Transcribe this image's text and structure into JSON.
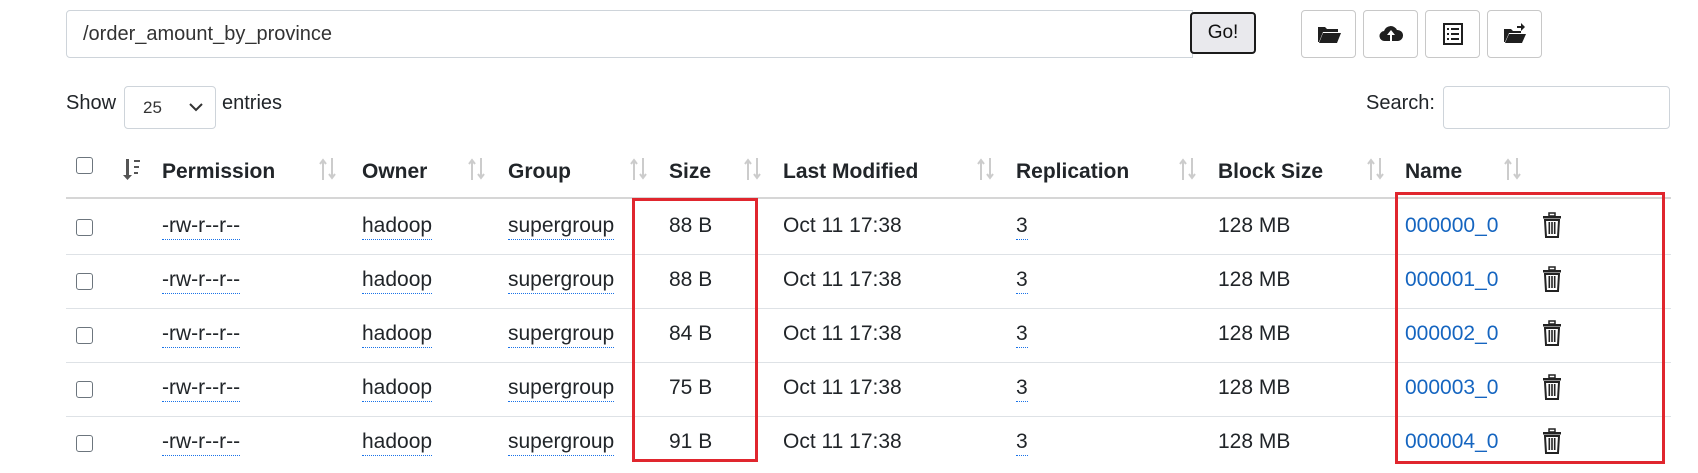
{
  "path_bar": {
    "value": "/order_amount_by_province",
    "go_label": "Go!"
  },
  "toolbar": {
    "icons": [
      "folder-open-icon",
      "cloud-upload-icon",
      "list-icon",
      "folder-move-icon"
    ]
  },
  "length_menu": {
    "show_label": "Show",
    "selected": "25",
    "entries_label": "entries"
  },
  "search": {
    "label": "Search:",
    "value": ""
  },
  "table": {
    "headers": {
      "permission": "Permission",
      "owner": "Owner",
      "group": "Group",
      "size": "Size",
      "last_modified": "Last Modified",
      "replication": "Replication",
      "block_size": "Block Size",
      "name": "Name"
    },
    "rows": [
      {
        "permission": "-rw-r--r--",
        "owner": "hadoop",
        "group": "supergroup",
        "size": "88 B",
        "last_modified": "Oct 11 17:38",
        "replication": "3",
        "block_size": "128 MB",
        "name": "000000_0"
      },
      {
        "permission": "-rw-r--r--",
        "owner": "hadoop",
        "group": "supergroup",
        "size": "88 B",
        "last_modified": "Oct 11 17:38",
        "replication": "3",
        "block_size": "128 MB",
        "name": "000001_0"
      },
      {
        "permission": "-rw-r--r--",
        "owner": "hadoop",
        "group": "supergroup",
        "size": "84 B",
        "last_modified": "Oct 11 17:38",
        "replication": "3",
        "block_size": "128 MB",
        "name": "000002_0"
      },
      {
        "permission": "-rw-r--r--",
        "owner": "hadoop",
        "group": "supergroup",
        "size": "75 B",
        "last_modified": "Oct 11 17:38",
        "replication": "3",
        "block_size": "128 MB",
        "name": "000003_0"
      },
      {
        "permission": "-rw-r--r--",
        "owner": "hadoop",
        "group": "supergroup",
        "size": "91 B",
        "last_modified": "Oct 11 17:38",
        "replication": "3",
        "block_size": "128 MB",
        "name": "000004_0"
      }
    ]
  },
  "colors": {
    "link": "#1565c0",
    "highlight_box": "#e0262e"
  }
}
